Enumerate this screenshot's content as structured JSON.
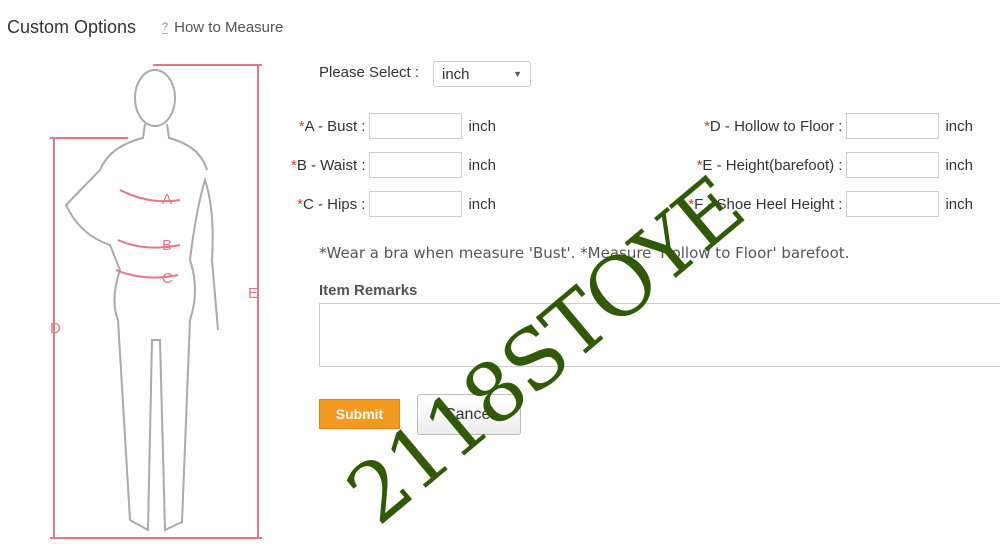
{
  "header": {
    "title": "Custom Options",
    "how_to_measure": "How to Measure",
    "help_icon": "question-icon"
  },
  "unit_select": {
    "label": "Please Select :",
    "value": "inch"
  },
  "fields": [
    {
      "label": "A - Bust :",
      "unit": "inch",
      "value": ""
    },
    {
      "label": "B - Waist :",
      "unit": "inch",
      "value": ""
    },
    {
      "label": "C - Hips :",
      "unit": "inch",
      "value": ""
    },
    {
      "label": "D - Hollow to Floor :",
      "unit": "inch",
      "value": ""
    },
    {
      "label": "E - Height(barefoot) :",
      "unit": "inch",
      "value": ""
    },
    {
      "label": "F - Shoe Heel Height :",
      "unit": "inch",
      "value": ""
    }
  ],
  "required_mark": "*",
  "note": "*Wear a bra when measure 'Bust'. *Measure 'Hollow to Floor' barefoot.",
  "remarks": {
    "label": "Item Remarks",
    "value": ""
  },
  "buttons": {
    "submit": "Submit",
    "cancel": "Cancel"
  },
  "figure": {
    "labels": [
      "A",
      "B",
      "C",
      "D",
      "E"
    ]
  },
  "watermark": "2118STOYE",
  "colors": {
    "accent": "#f39a1f",
    "measure_line": "#e07a8a",
    "watermark": "#2f5a06"
  }
}
